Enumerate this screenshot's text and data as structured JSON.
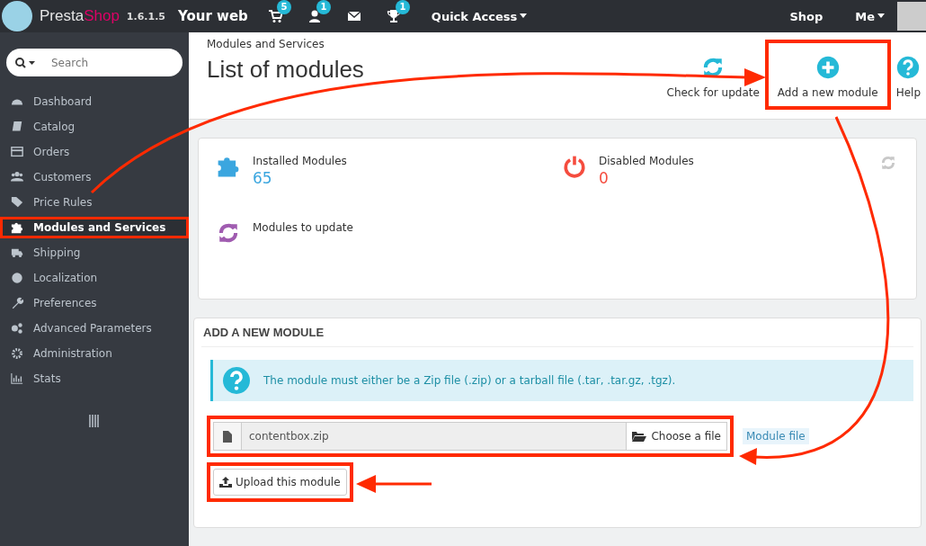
{
  "topbar": {
    "brand_first": "Presta",
    "brand_second": "Shop",
    "version": "1.6.1.5",
    "shop_name": "Your web",
    "notifications": [
      {
        "kind": "cart",
        "count": "5"
      },
      {
        "kind": "user",
        "count": "1"
      },
      {
        "kind": "mail"
      },
      {
        "kind": "trophy",
        "count": "1"
      }
    ],
    "quick_access": "Quick Access",
    "shop_link": "Shop",
    "me_menu": "Me"
  },
  "sidebar": {
    "search": {
      "placeholder": "Search"
    },
    "items": [
      {
        "label": "Dashboard",
        "selected": false,
        "highlighted": false
      },
      {
        "label": "Catalog",
        "selected": false,
        "highlighted": false
      },
      {
        "label": "Orders",
        "selected": false,
        "highlighted": false
      },
      {
        "label": "Customers",
        "selected": false,
        "highlighted": false
      },
      {
        "label": "Price Rules",
        "selected": false,
        "highlighted": false
      },
      {
        "label": "Modules and Services",
        "selected": true,
        "highlighted": true
      },
      {
        "label": "Shipping",
        "selected": false,
        "highlighted": false
      },
      {
        "label": "Localization",
        "selected": false,
        "highlighted": false
      },
      {
        "label": "Preferences",
        "selected": false,
        "highlighted": false
      },
      {
        "label": "Advanced Parameters",
        "selected": false,
        "highlighted": false
      },
      {
        "label": "Administration",
        "selected": false,
        "highlighted": false
      },
      {
        "label": "Stats",
        "selected": false,
        "highlighted": false
      }
    ]
  },
  "header": {
    "breadcrumb": "Modules and Services",
    "title": "List of modules",
    "toolbar": [
      {
        "label": "Check for update",
        "highlighted": false
      },
      {
        "label": "Add a new module",
        "highlighted": true
      },
      {
        "label": "Help",
        "highlighted": false
      }
    ]
  },
  "stats": [
    {
      "label": "Installed Modules",
      "value": "65",
      "color": "#3ba6df"
    },
    {
      "label": "Disabled Modules",
      "value": "0",
      "color": "#f54c3e"
    },
    {
      "label": "Modules to update",
      "color": "#a05cb0"
    }
  ],
  "upload_panel": {
    "heading": "ADD A NEW MODULE",
    "info": "The module must either be a Zip file (.zip) or a tarball file (.tar, .tar.gz, .tgz).",
    "file": {
      "value": "contentbox.zip",
      "button": "Choose a file",
      "highlighted": true
    },
    "field_label": "Module file",
    "upload_button": {
      "label": "Upload this module",
      "highlighted": true
    }
  }
}
